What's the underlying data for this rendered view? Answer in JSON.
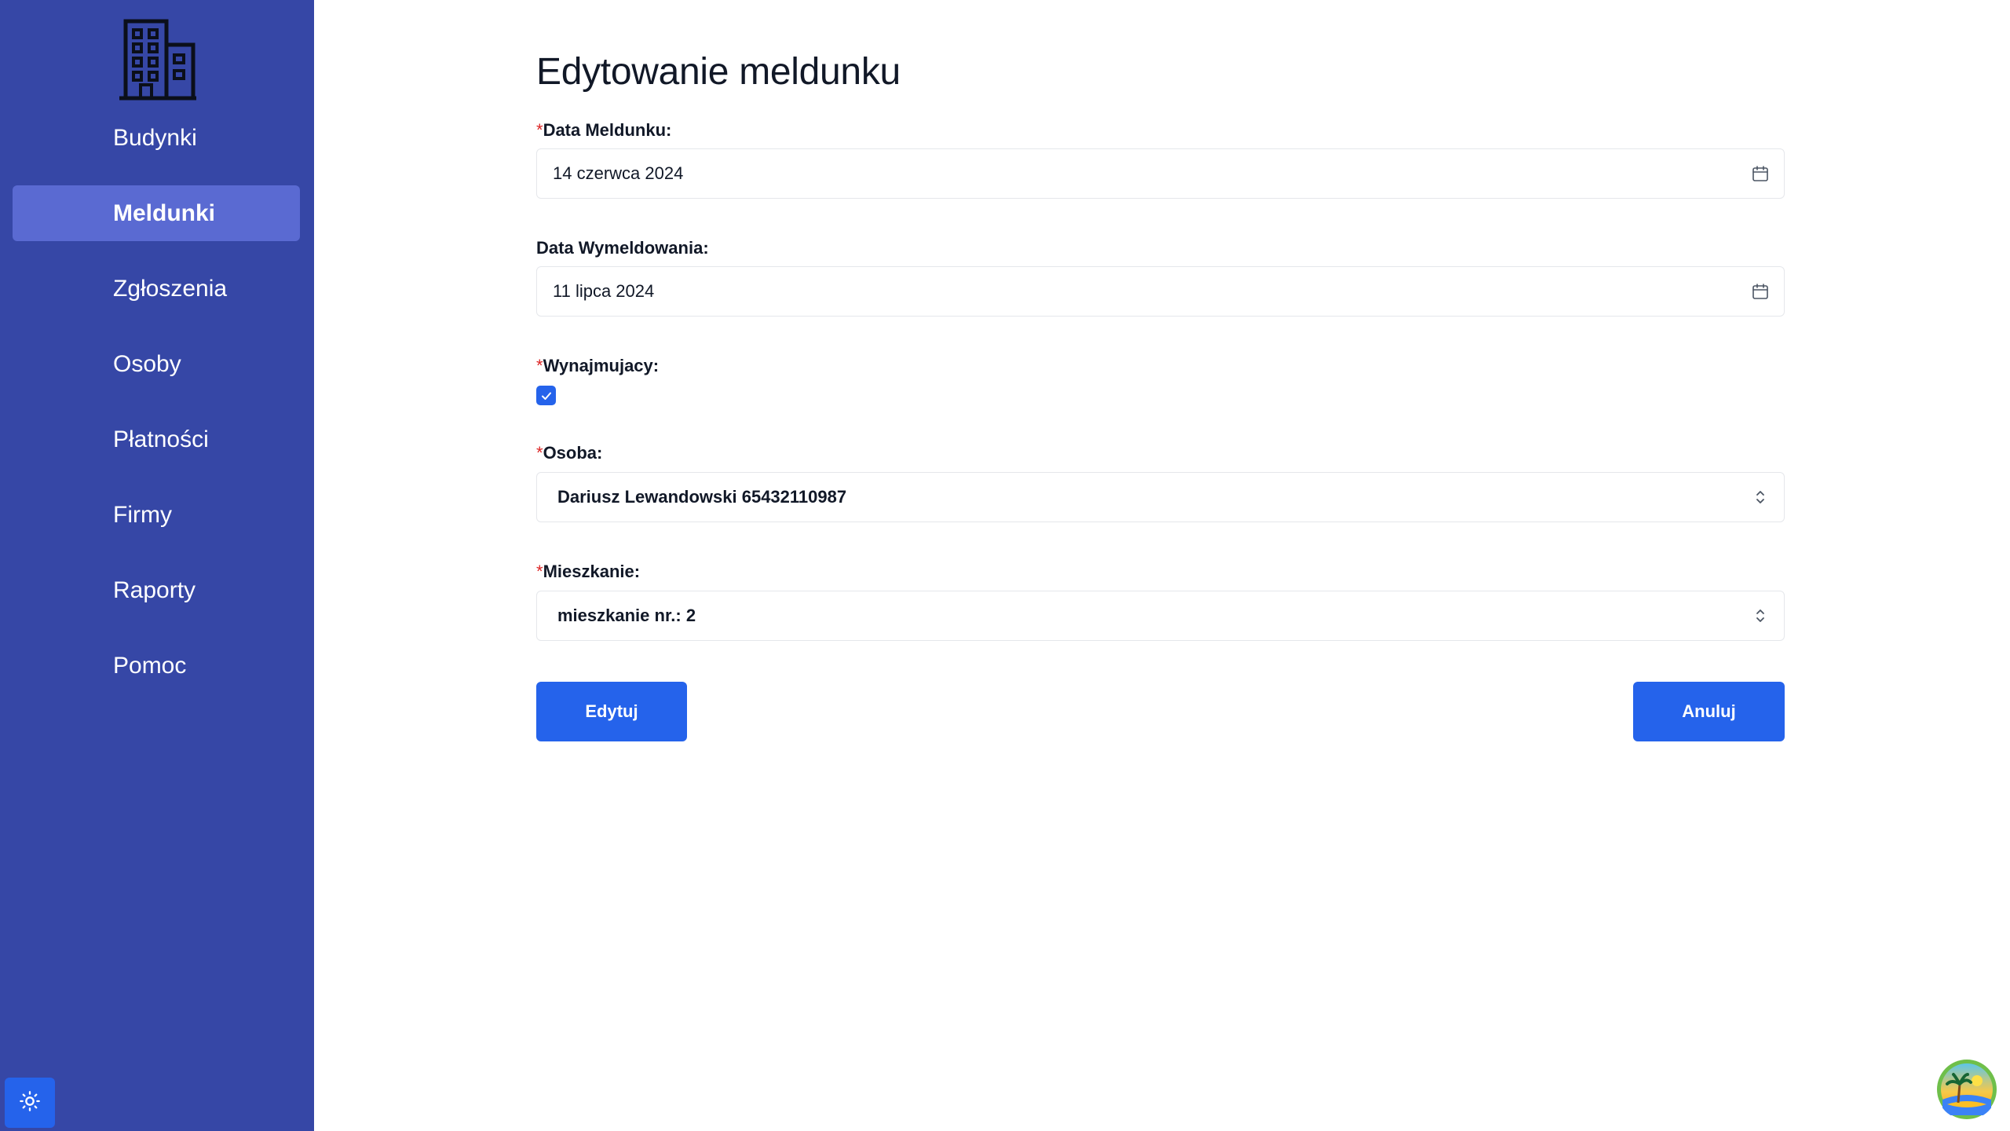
{
  "nav": {
    "items": [
      {
        "label": "Budynki",
        "active": false
      },
      {
        "label": "Meldunki",
        "active": true
      },
      {
        "label": "Zgłoszenia",
        "active": false
      },
      {
        "label": "Osoby",
        "active": false
      },
      {
        "label": "Płatności",
        "active": false
      },
      {
        "label": "Firmy",
        "active": false
      },
      {
        "label": "Raporty",
        "active": false
      },
      {
        "label": "Pomoc",
        "active": false
      }
    ],
    "logo_icon": "building-icon",
    "theme_icon": "sun-icon"
  },
  "form": {
    "title": "Edytowanie meldunku",
    "required_mark": "*",
    "checkin": {
      "label": "Data Meldunku:",
      "value": "14 czerwca 2024",
      "icon": "calendar-icon"
    },
    "checkout": {
      "label": "Data Wymeldowania:",
      "value": "11 lipca 2024",
      "icon": "calendar-icon"
    },
    "renter": {
      "label": "Wynajmujacy:",
      "checked": true
    },
    "person": {
      "label": "Osoba:",
      "value": "Dariusz Lewandowski 65432110987",
      "icon": "chevron-updown-icon"
    },
    "apartment": {
      "label": "Mieszkanie:",
      "value": "mieszkanie nr.: 2",
      "icon": "chevron-updown-icon"
    },
    "submit_label": "Edytuj",
    "cancel_label": "Anuluj"
  },
  "colors": {
    "sidebar_bg": "#3647a6",
    "sidebar_active": "#5a6ad2",
    "primary": "#2563eb",
    "required": "#dc2626"
  }
}
